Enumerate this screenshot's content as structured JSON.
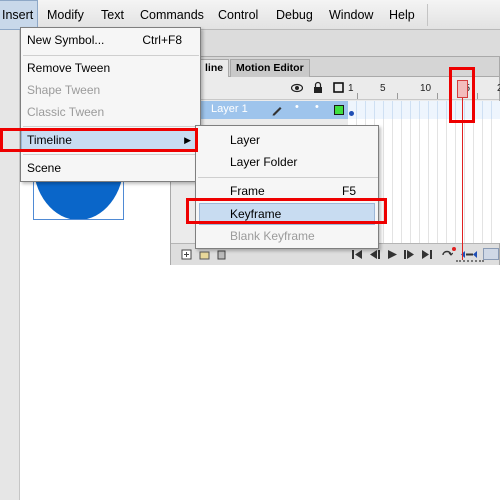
{
  "menubar": {
    "items": [
      {
        "label": "Insert"
      },
      {
        "label": "Modify"
      },
      {
        "label": "Text"
      },
      {
        "label": "Commands"
      },
      {
        "label": "Control"
      },
      {
        "label": "Debug"
      },
      {
        "label": "Window"
      },
      {
        "label": "Help"
      }
    ]
  },
  "insert_menu": {
    "items": [
      {
        "label": "New Symbol...",
        "shortcut": "Ctrl+F8",
        "enabled": true
      },
      {
        "label": "Remove Tween",
        "enabled": true
      },
      {
        "label": "Shape Tween",
        "enabled": false
      },
      {
        "label": "Classic Tween",
        "enabled": false
      },
      {
        "label": "Timeline",
        "submenu": true,
        "highlighted": true
      },
      {
        "label": "Scene",
        "enabled": true
      }
    ]
  },
  "timeline_submenu": {
    "items": [
      {
        "label": "Layer",
        "enabled": true
      },
      {
        "label": "Layer Folder",
        "enabled": true
      },
      {
        "label": "Frame",
        "shortcut": "F5",
        "enabled": true
      },
      {
        "label": "Keyframe",
        "enabled": true,
        "highlighted": true
      },
      {
        "label": "Blank Keyframe",
        "enabled": false
      }
    ]
  },
  "timeline_panel": {
    "tabs": [
      {
        "label": "line",
        "active": true
      },
      {
        "label": "Motion Editor",
        "active": false
      }
    ],
    "ruler": [
      "1",
      "5",
      "10",
      "15",
      "2"
    ],
    "layer": {
      "name": "Layer 1"
    },
    "playhead_frame": 15
  },
  "colors": {
    "highlight": "#c8dcf1",
    "annotation": "#ee0000",
    "circle_fill": "#0a66c9",
    "layer_row": "#9ec4ec"
  },
  "icons": [
    "eye-icon",
    "lock-icon",
    "outline-square-icon",
    "pencil-icon",
    "submenu-arrow-icon",
    "new-layer-icon",
    "play-icon",
    "loop-icon"
  ]
}
